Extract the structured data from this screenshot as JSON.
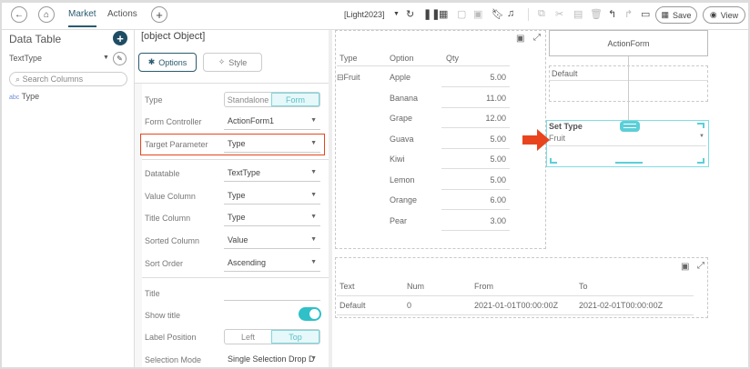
{
  "topbar": {
    "tabs": [
      {
        "label": "Market",
        "active": true
      },
      {
        "label": "Actions",
        "active": false
      }
    ],
    "theme_select": "[Light2023]",
    "save_label": "Save",
    "view_label": "View"
  },
  "left_panel": {
    "title": "Data Table",
    "table_select": "TextType",
    "search_placeholder": "Search Columns",
    "columns": [
      {
        "type_badge": "abc",
        "name": "Type"
      }
    ]
  },
  "props": {
    "title": {
      "label": "Title",
      "value": ""
    },
    "tabs": {
      "options": "Options",
      "style": "Style"
    },
    "type": {
      "label": "Type",
      "options": [
        "Standalone",
        "Form"
      ],
      "selected": "Form"
    },
    "form_controller": {
      "label": "Form Controller",
      "value": "ActionForm1"
    },
    "target_parameter": {
      "label": "Target Parameter",
      "value": "Type"
    },
    "datatable": {
      "label": "Datatable",
      "value": "TextType"
    },
    "value_column": {
      "label": "Value Column",
      "value": "Type"
    },
    "title_column": {
      "label": "Title Column",
      "value": "Type"
    },
    "sorted_column": {
      "label": "Sorted Column",
      "value": "Value"
    },
    "sort_order": {
      "label": "Sort Order",
      "value": "Ascending"
    },
    "show_title": {
      "label": "Show title",
      "on": true
    },
    "label_position": {
      "label": "Label Position",
      "options": [
        "Left",
        "Top"
      ],
      "selected": "Top"
    },
    "selection_mode": {
      "label": "Selection Mode",
      "value": "Single Selection Drop D"
    }
  },
  "grid": {
    "headers": [
      "Type",
      "Option",
      "Qty"
    ],
    "group": "Fruit",
    "rows": [
      [
        "Apple",
        "5.00"
      ],
      [
        "Banana",
        "11.00"
      ],
      [
        "Grape",
        "12.00"
      ],
      [
        "Guava",
        "5.00"
      ],
      [
        "Kiwi",
        "5.00"
      ],
      [
        "Lemon",
        "5.00"
      ],
      [
        "Orange",
        "6.00"
      ],
      [
        "Pear",
        "3.00"
      ]
    ]
  },
  "form": {
    "title": "ActionForm",
    "default_label": "Default",
    "dropdown_label": "Set Type",
    "dropdown_value": "Fruit"
  },
  "param_table": {
    "headers": [
      "Text",
      "Num",
      "From",
      "To"
    ],
    "rows": [
      [
        "Default",
        "0",
        "2021-01-01T00:00:00Z",
        "2021-02-01T00:00:00Z"
      ]
    ]
  },
  "colors": {
    "accent": "#2a5b70",
    "highlight": "#e8451e",
    "teal": "#5bcfd8"
  }
}
